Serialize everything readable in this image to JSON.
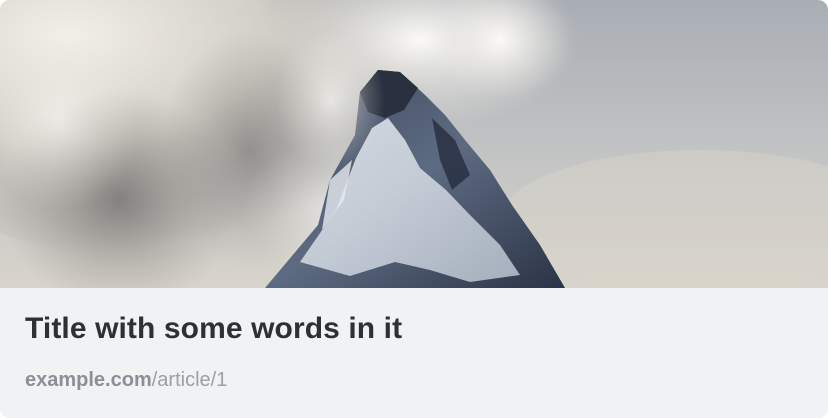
{
  "card": {
    "title": "Title with some words in it",
    "link_domain": "example.com",
    "link_path": "/article/1",
    "image_subject": "snow-capped-mountain-peak-in-clouds"
  },
  "colors": {
    "footer_bg": "#f1f2f4",
    "title_text": "#2e3034",
    "link_text": "#8f969e",
    "sky": "#b9bcc0",
    "cloud_light": "#e6e4de",
    "cloud_dark": "#8f8c87",
    "rock_dark": "#2c3447",
    "snow": "#dde3ea"
  }
}
